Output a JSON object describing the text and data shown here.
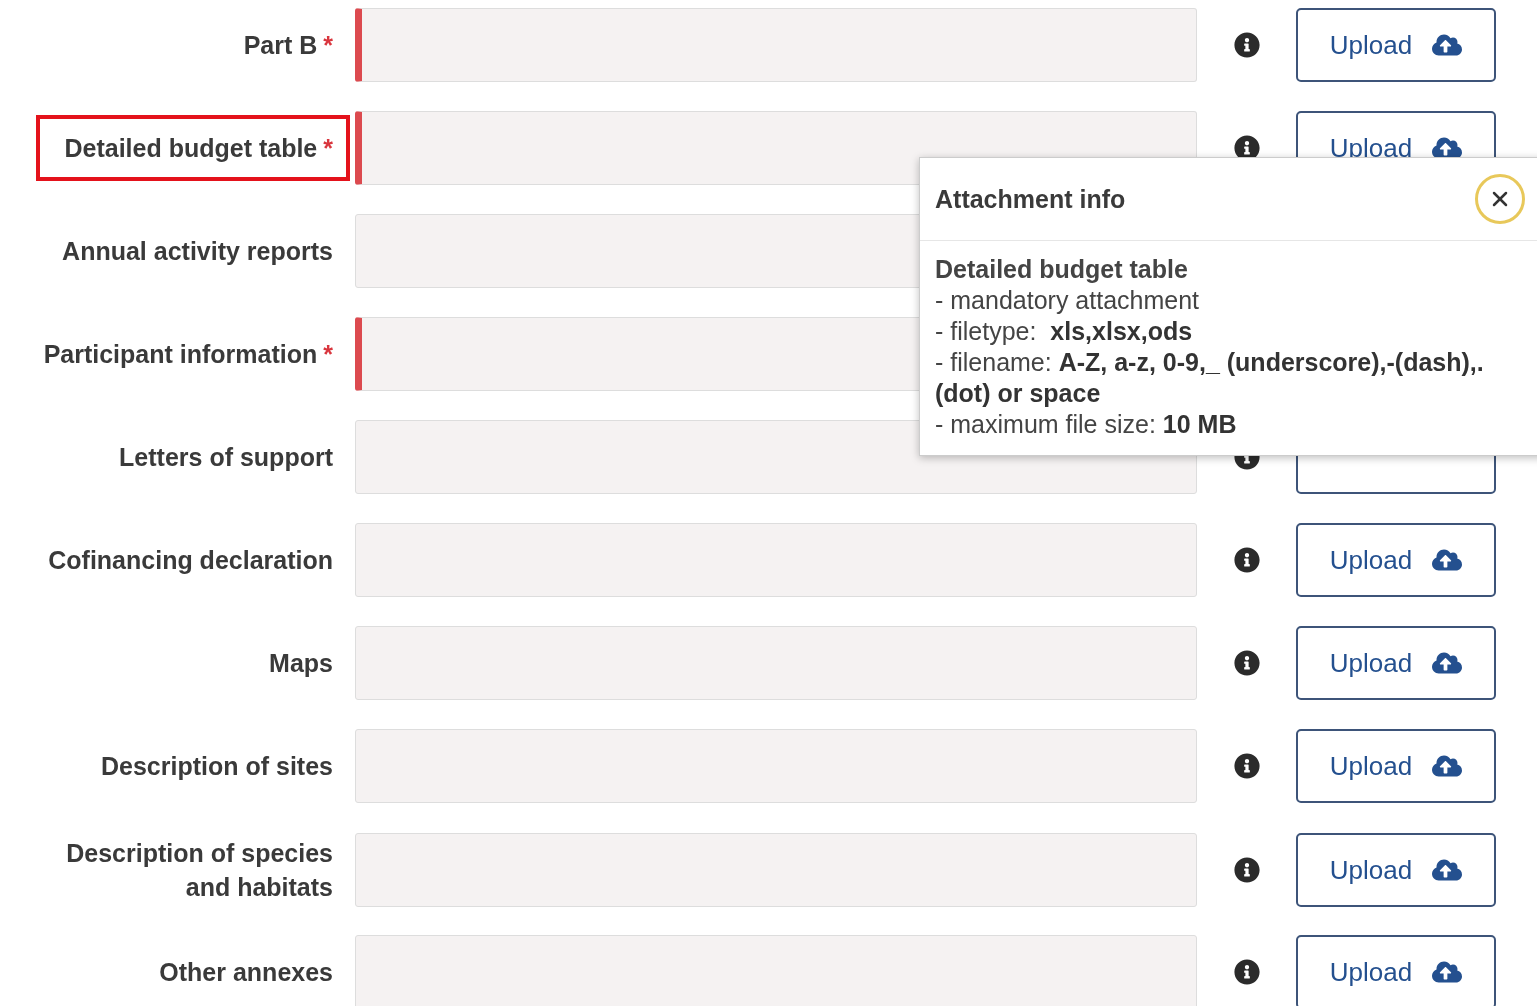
{
  "required_mark": "*",
  "rows": [
    {
      "label": "Part B",
      "required": true,
      "highlighted": false,
      "upload": "Upload"
    },
    {
      "label": "Detailed budget table",
      "required": true,
      "highlighted": true,
      "upload": "Upload"
    },
    {
      "label": "Annual activity reports",
      "required": false,
      "highlighted": false,
      "upload": null
    },
    {
      "label": "Participant information",
      "required": true,
      "highlighted": false,
      "upload": null
    },
    {
      "label": "Letters of support",
      "required": false,
      "highlighted": false,
      "upload": null,
      "button_partly_hidden": true
    },
    {
      "label": "Cofinancing declaration",
      "required": false,
      "highlighted": false,
      "upload": "Upload"
    },
    {
      "label": "Maps",
      "required": false,
      "highlighted": false,
      "upload": "Upload"
    },
    {
      "label": "Description of sites",
      "required": false,
      "highlighted": false,
      "upload": "Upload"
    },
    {
      "label": "Description of species and habitats",
      "required": false,
      "highlighted": false,
      "upload": "Upload"
    },
    {
      "label": "Other annexes",
      "required": false,
      "highlighted": false,
      "upload": "Upload"
    }
  ],
  "popover": {
    "title": "Attachment info",
    "close_focused": true,
    "heading": "Detailed budget table",
    "lines": [
      "- mandatory attachment",
      "- filetype:  **xls,xlsx,ods**",
      "- filename: **A-Z, a-z, 0-9,_ (underscore),-(dash),. (dot) or space**",
      "- maximum file size: **10 MB**"
    ]
  }
}
